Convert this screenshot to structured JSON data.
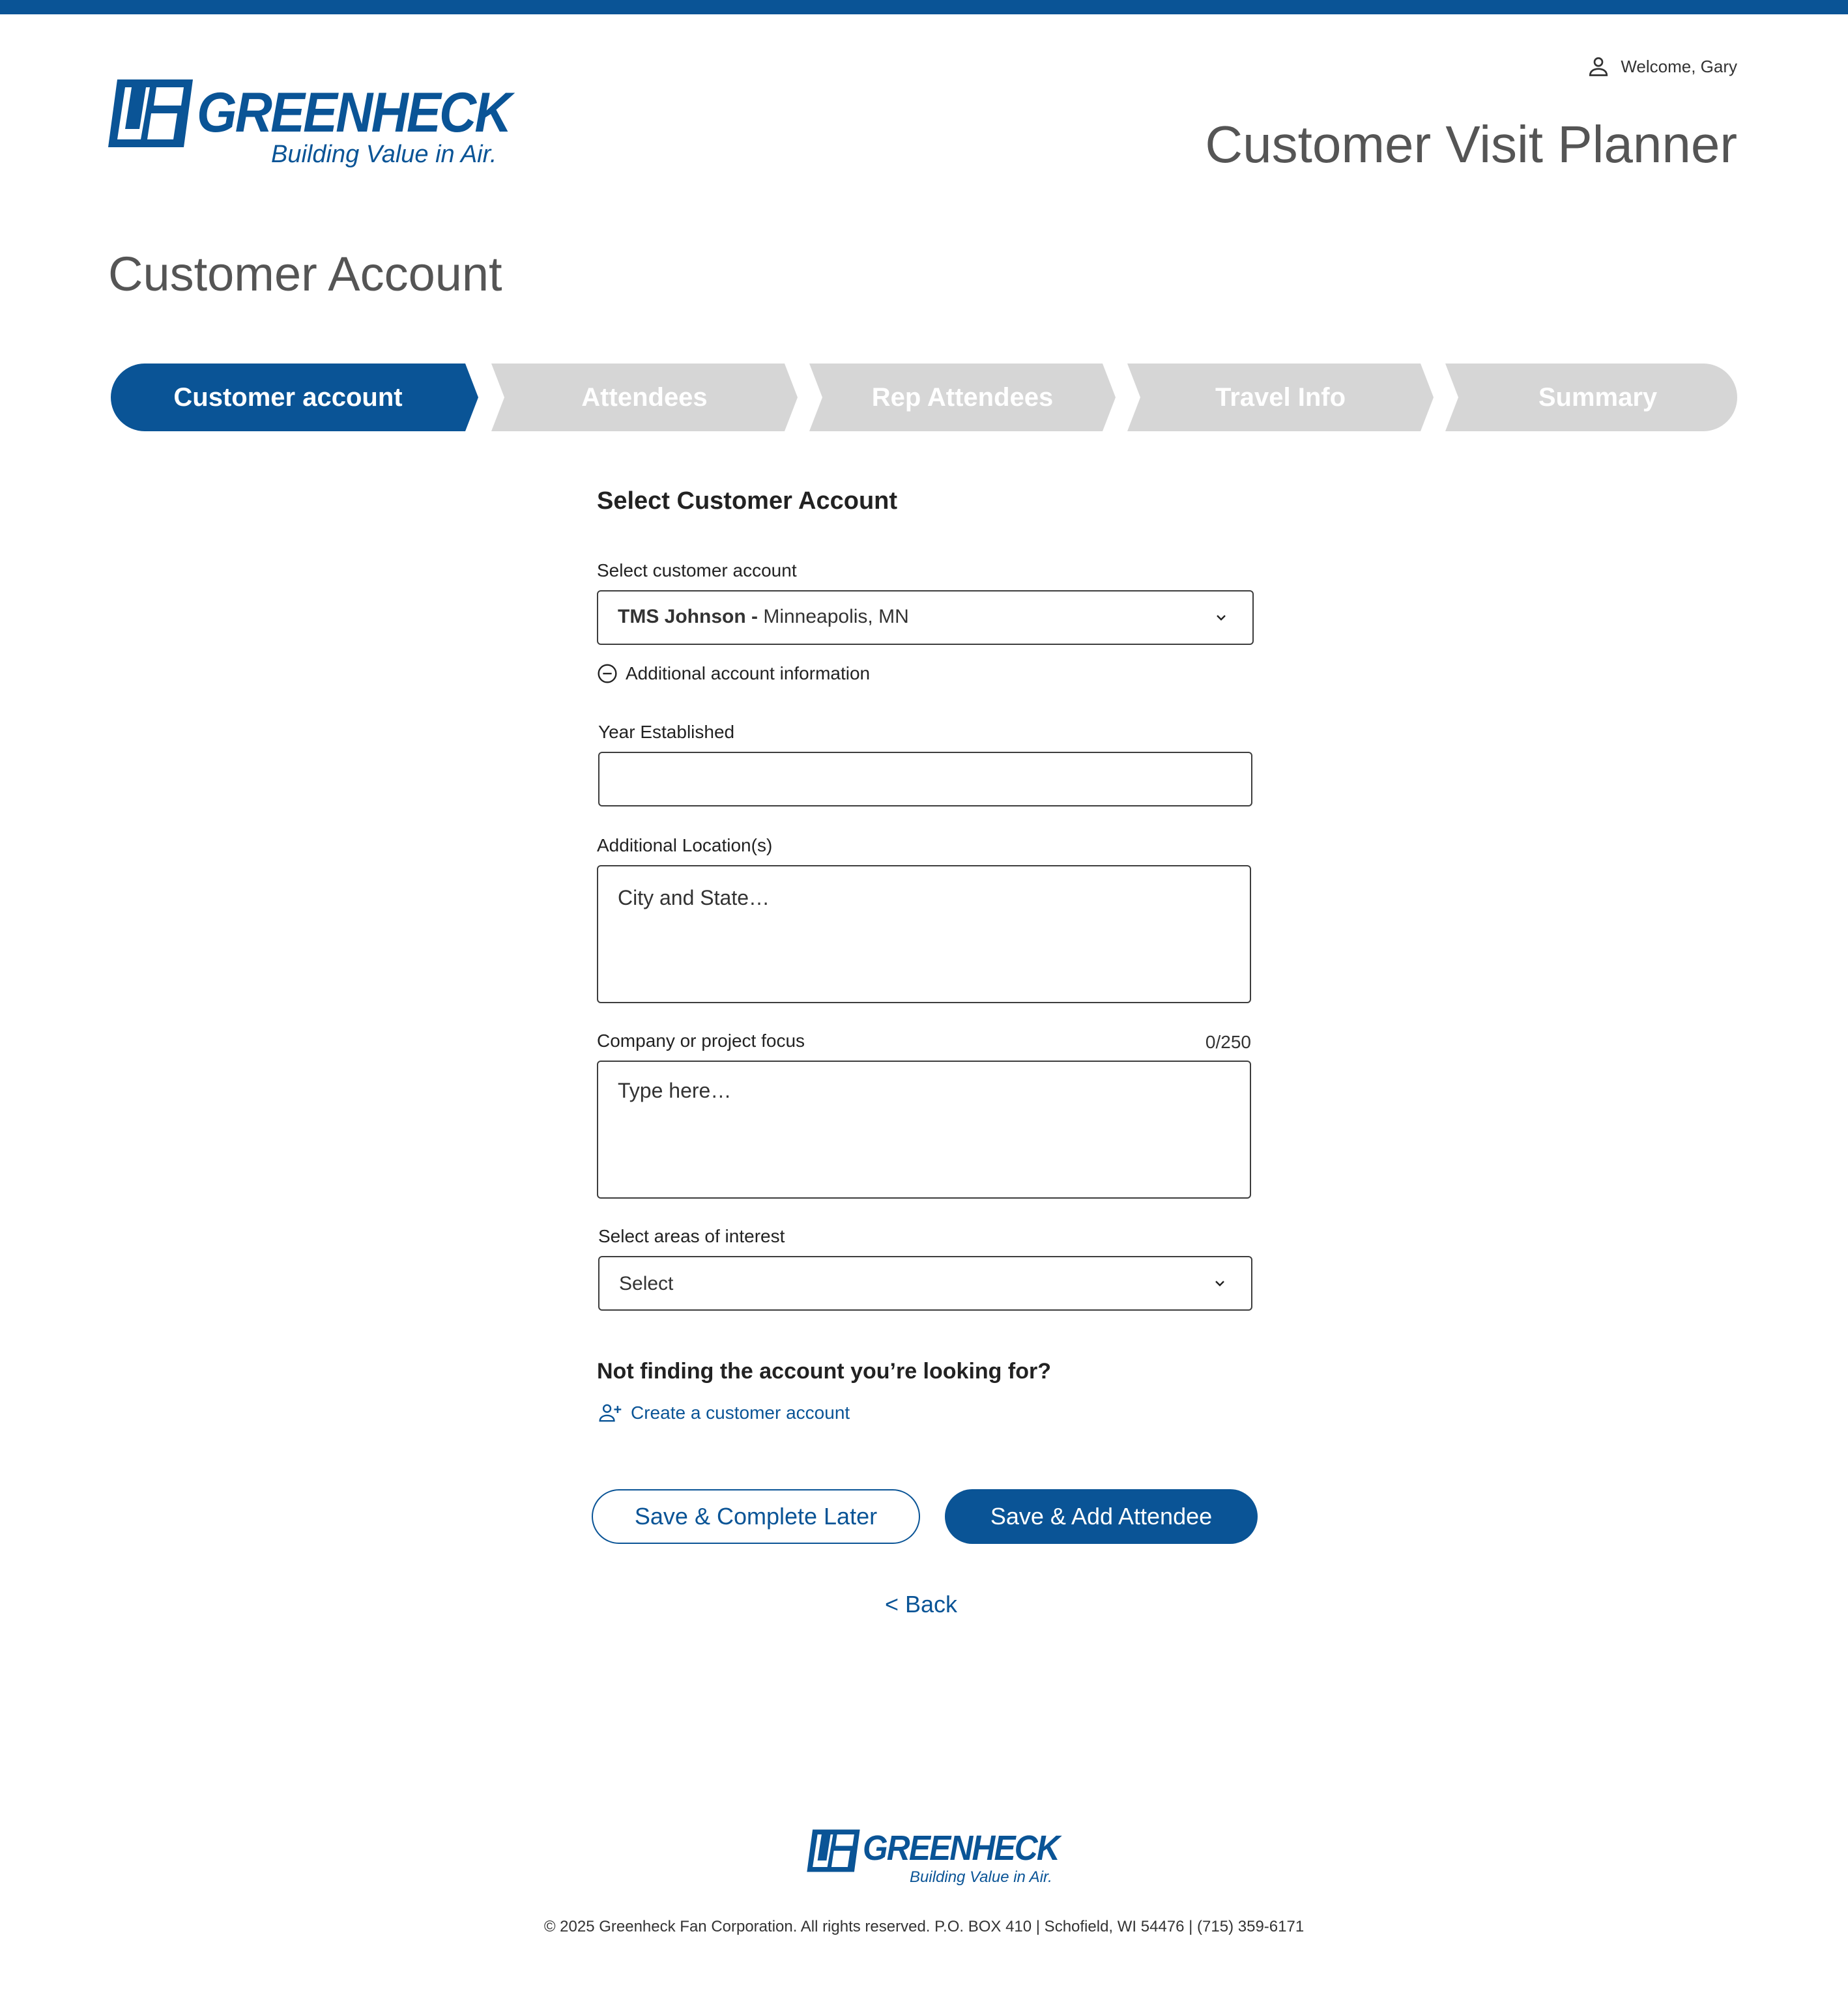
{
  "header": {
    "logo_word": "GREENHECK",
    "logo_tagline": "Building Value in Air.",
    "welcome": "Welcome, Gary",
    "app_title": "Customer Visit Planner"
  },
  "page": {
    "title": "Customer Account"
  },
  "stepper": {
    "steps": [
      {
        "label": "Customer account",
        "active": true
      },
      {
        "label": "Attendees",
        "active": false
      },
      {
        "label": "Rep Attendees",
        "active": false
      },
      {
        "label": "Travel Info",
        "active": false
      },
      {
        "label": "Summary",
        "active": false
      }
    ]
  },
  "form": {
    "section_title": "Select Customer Account",
    "account": {
      "label": "Select customer account",
      "selected_name": "TMS Johnson -",
      "selected_location": "Minneapolis, MN"
    },
    "additional_info_toggle": "Additional account information",
    "year_established": {
      "label": "Year Established",
      "value": ""
    },
    "additional_locations": {
      "label": "Additional Location(s)",
      "placeholder": "City and State…"
    },
    "company_focus": {
      "label": "Company or project focus",
      "placeholder": "Type here…",
      "counter": "0/250"
    },
    "areas_of_interest": {
      "label": "Select areas of interest",
      "value": "Select"
    }
  },
  "not_finding": {
    "title": "Not finding the account you’re looking for?",
    "create_link": "Create a customer account"
  },
  "actions": {
    "save_later": "Save & Complete Later",
    "save_add": "Save & Add Attendee",
    "back": "< Back"
  },
  "footer": {
    "logo_word": "GREENHECK",
    "logo_tagline": "Building Value in Air.",
    "copyright": "© 2025 Greenheck Fan Corporation. All rights reserved.  P.O. BOX 410  |  Schofield, WI 54476  |  (715) 359-6171"
  },
  "colors": {
    "brand": "#0a5496",
    "inactive_step": "#d6d6d6",
    "heading_gray": "#555555"
  },
  "icons": [
    "user-icon",
    "minus-circle-icon",
    "chevron-down-icon",
    "add-user-icon"
  ]
}
